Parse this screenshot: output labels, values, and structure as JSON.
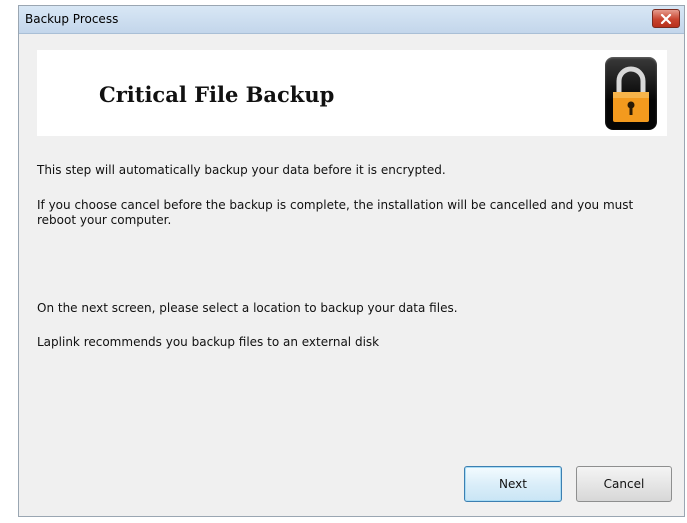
{
  "window": {
    "title": "Backup Process"
  },
  "header": {
    "title": "Critical File Backup",
    "icon": "padlock-icon"
  },
  "body": {
    "line1": "This step will automatically backup your data before it is encrypted.",
    "line2": "If you choose cancel before the backup is complete, the installation will be cancelled and you must reboot your computer.",
    "line3": "On the next screen, please select a location to backup your data files.",
    "line4": "Laplink recommends you backup files to an external disk"
  },
  "buttons": {
    "next_label": "Next",
    "cancel_label": "Cancel"
  },
  "colors": {
    "lock_orange": "#f39a1e",
    "close_red": "#c8442f"
  }
}
